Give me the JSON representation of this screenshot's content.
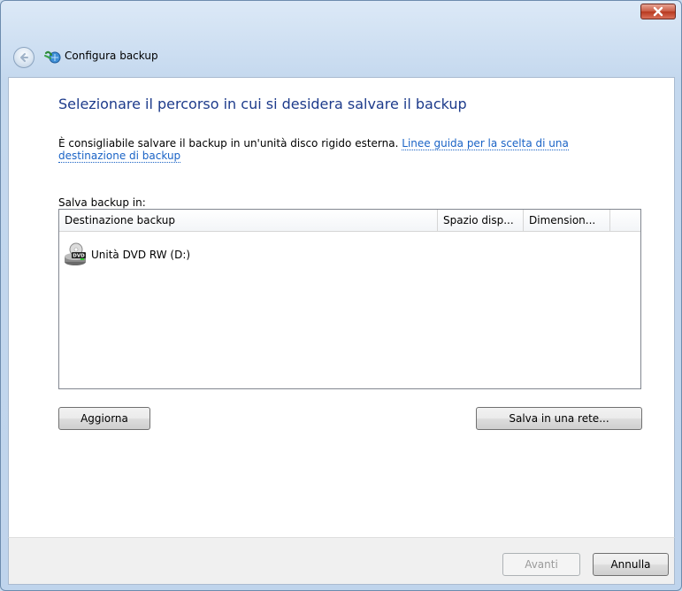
{
  "window": {
    "title": "Configura backup",
    "back_button": "back-arrow-icon",
    "close_button": "close-icon"
  },
  "main": {
    "heading": "Selezionare il percorso in cui si desidera salvare il backup",
    "description_text": "È consigliabile salvare il backup in un'unità disco rigido esterna.",
    "description_link": "Linee guida per la scelta di una destinazione di backup",
    "save_label": "Salva backup in:",
    "list": {
      "columns": [
        "Destinazione backup",
        "Spazio disp...",
        "Dimension..."
      ],
      "rows": [
        {
          "icon": "dvd-drive-icon",
          "name": "Unità DVD RW (D:)",
          "free_space": "",
          "size": ""
        }
      ]
    },
    "refresh_button": "Aggiorna",
    "network_button": "Salva in una rete..."
  },
  "footer": {
    "next_button": "Avanti",
    "cancel_button": "Annulla"
  }
}
